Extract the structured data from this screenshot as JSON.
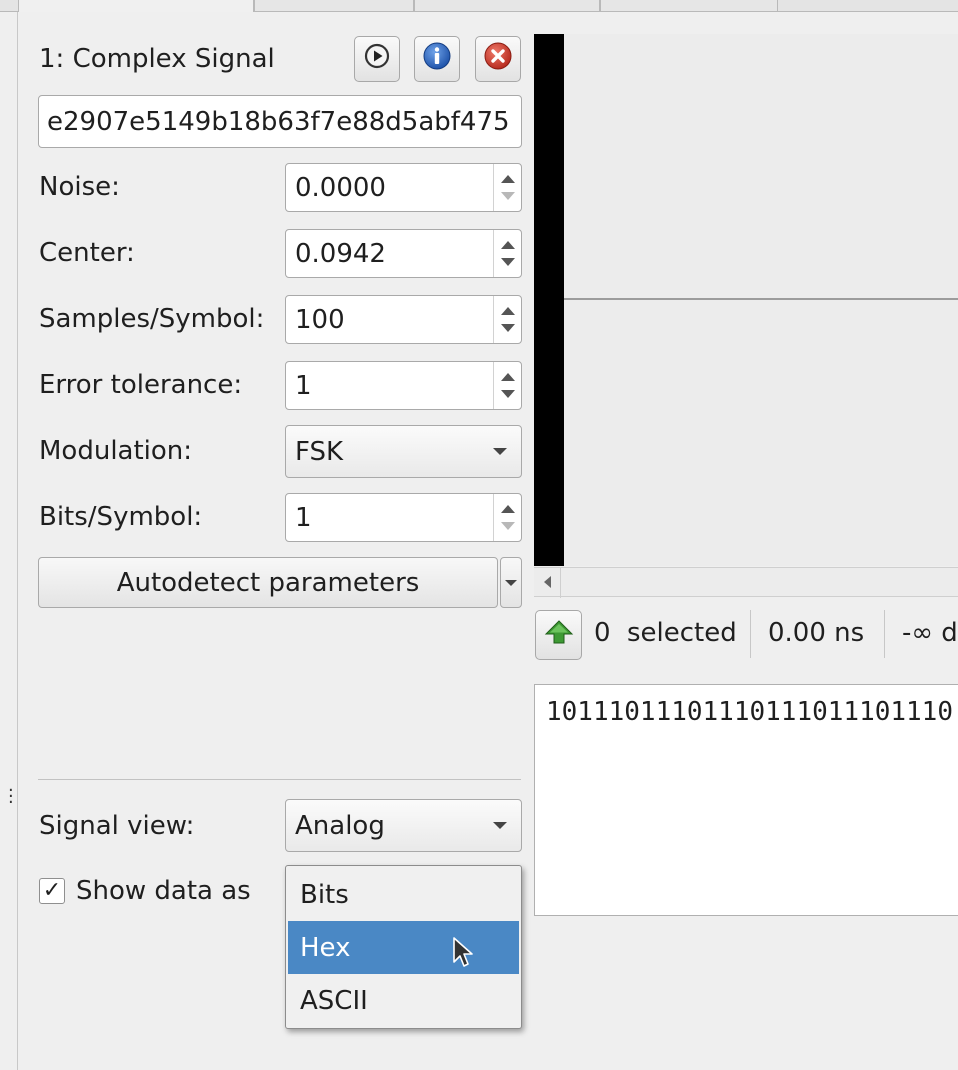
{
  "tabs": [
    {
      "label": ""
    },
    {
      "label": ""
    },
    {
      "label": ""
    },
    {
      "label": ""
    }
  ],
  "signal": {
    "title": "1:  Complex Signal",
    "id_value": "e2907e5149b18b63f7e88d5abf475",
    "toolbar_icons": [
      "play-icon",
      "info-icon",
      "close-icon"
    ]
  },
  "params": {
    "noise_label": "Noise:",
    "noise_value": "0.0000",
    "center_label": "Center:",
    "center_value": "0.0942",
    "samples_label": "Samples/Symbol:",
    "samples_value": "100",
    "error_label": "Error tolerance:",
    "error_value": "1",
    "modulation_label": "Modulation:",
    "modulation_value": "FSK",
    "bits_label": "Bits/Symbol:",
    "bits_value": "1",
    "autodetect_label": "Autodetect parameters"
  },
  "view": {
    "signal_view_label": "Signal view:",
    "signal_view_value": "Analog",
    "show_data_label": "Show data as",
    "show_data_checked": true,
    "dropdown_options": [
      "Bits",
      "Hex",
      "ASCII"
    ],
    "dropdown_selected": "Hex"
  },
  "status": {
    "selected_count": "0",
    "selected_label": "selected",
    "duration": "0.00 ns",
    "extra": "-∞ d"
  },
  "data_view": {
    "text": "10111011101110111011101110"
  },
  "colors": {
    "selection": "#4a88c5",
    "background": "#efefef"
  }
}
